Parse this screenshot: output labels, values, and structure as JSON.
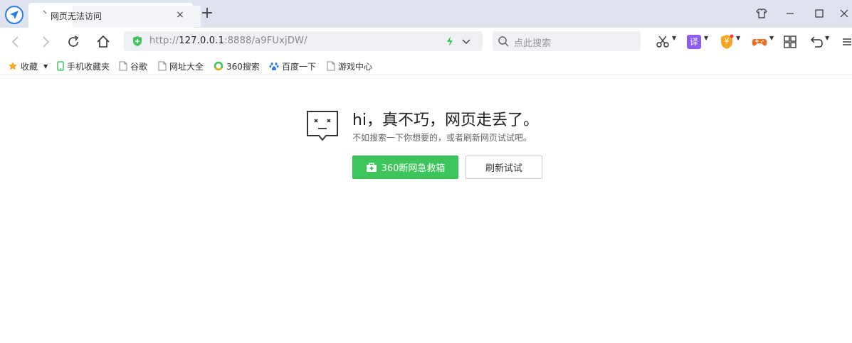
{
  "tab": {
    "title": "网页无法访问",
    "close_glyph": "×",
    "new_tab_glyph": "+"
  },
  "address": {
    "scheme": "http://",
    "host": "127.0.0.1",
    "rest": ":8888/a9FUxjDW/"
  },
  "search": {
    "placeholder": "点此搜索"
  },
  "toolbar": {
    "translate_label": "译",
    "wallet_label": "¥"
  },
  "bookmarks": [
    {
      "label": "收藏",
      "icon": "star-icon"
    },
    {
      "label": "手机收藏夹",
      "icon": "phone-icon"
    },
    {
      "label": "谷歌",
      "icon": "page-icon"
    },
    {
      "label": "网址大全",
      "icon": "page-icon"
    },
    {
      "label": "360搜索",
      "icon": "360-search-icon"
    },
    {
      "label": "百度一下",
      "icon": "baidu-paw-icon"
    },
    {
      "label": "游戏中心",
      "icon": "page-icon"
    }
  ],
  "error": {
    "title": "hi，真不巧，网页走丢了。",
    "subtitle": "不如搜索一下你想要的，或者刷新网页试试吧。",
    "rescue_button": "360断网急救箱",
    "refresh_button": "刷新试试"
  },
  "colors": {
    "accent_green": "#3cc55b",
    "tab_bar": "#dfe3ee",
    "logo_blue": "#2c7be5"
  }
}
